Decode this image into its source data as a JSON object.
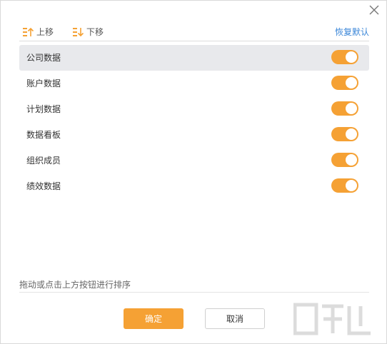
{
  "toolbar": {
    "move_up_label": "上移",
    "move_down_label": "下移",
    "reset_label": "恢复默认"
  },
  "items": [
    {
      "label": "公司数据",
      "enabled": true,
      "selected": true
    },
    {
      "label": "账户数据",
      "enabled": true,
      "selected": false
    },
    {
      "label": "计划数据",
      "enabled": true,
      "selected": false
    },
    {
      "label": "数据看板",
      "enabled": true,
      "selected": false
    },
    {
      "label": "组织成员",
      "enabled": true,
      "selected": false
    },
    {
      "label": "绩效数据",
      "enabled": true,
      "selected": false
    }
  ],
  "hint": "拖动或点击上方按钮进行排序",
  "buttons": {
    "ok_label": "确定",
    "cancel_label": "取消"
  },
  "colors": {
    "accent": "#f5a134",
    "link": "#3a86d8",
    "selected_row": "#e8e9ec"
  },
  "icons": [
    "close-icon",
    "move-up-icon",
    "move-down-icon"
  ]
}
